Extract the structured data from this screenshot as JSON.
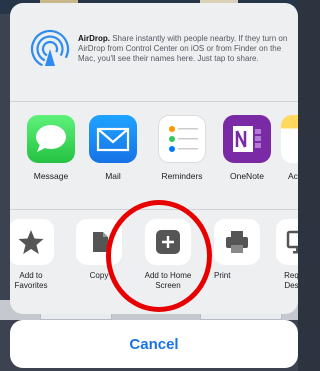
{
  "airdrop": {
    "title": "AirDrop.",
    "body": " Share instantly with people nearby. If they turn on AirDrop from Control Center on iOS or from Finder on the Mac, you'll see their names here. Just tap to share."
  },
  "apps": [
    {
      "label": "Message",
      "icon": "message-icon"
    },
    {
      "label": "Mail",
      "icon": "mail-icon"
    },
    {
      "label": "Reminders",
      "icon": "reminders-icon"
    },
    {
      "label": "OneNote",
      "icon": "onenote-icon"
    },
    {
      "label": "Ac",
      "icon": "notes-icon"
    }
  ],
  "actions": [
    {
      "label": "Add to Favorites",
      "icon": "star-icon"
    },
    {
      "label": "Copy",
      "icon": "copy-icon"
    },
    {
      "label": "Add to Home Screen",
      "icon": "plus-icon"
    },
    {
      "label": "Print",
      "icon": "printer-icon"
    },
    {
      "label": "Request Desktop",
      "icon": "desktop-icon"
    }
  ],
  "cancel_label": "Cancel",
  "colors": {
    "accent": "#1a73e8",
    "highlight": "#e60000"
  }
}
